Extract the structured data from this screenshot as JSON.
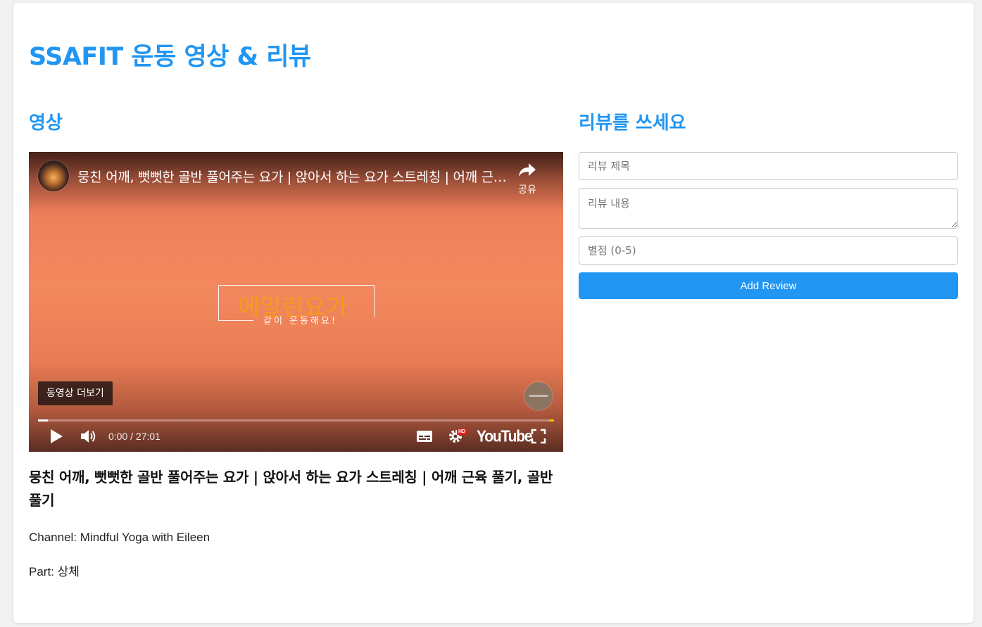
{
  "page": {
    "title": "SSAFIT 운동 영상 & 리뷰"
  },
  "video_section": {
    "heading": "영상",
    "player": {
      "overlay_title": "뭉친 어깨, 뻣뻣한 골반 풀어주는 요가 | 앉아서 하는 요가 스트레칭 | 어깨 근육 풀기, 골반풀기",
      "share_label": "공유",
      "center_logo_text": "에일린요가",
      "center_logo_subtext": "같이 운동해요!",
      "more_videos_label": "동영상 더보기",
      "time_display": "0:00 / 27:01",
      "hd_badge": "HD",
      "youtube_logo": "YouTube",
      "progress_fraction": 0.0,
      "icons": [
        "share-icon",
        "play-icon",
        "volume-icon",
        "subtitles-icon",
        "settings-icon",
        "fullscreen-icon"
      ]
    },
    "video_title": "뭉친 어깨, 뻣뻣한 골반 풀어주는 요가 | 앉아서 하는 요가 스트레칭 | 어깨 근육 풀기, 골반풀기",
    "channel_line": "Channel: Mindful Yoga with Eileen",
    "part_line": "Part: 상체"
  },
  "review_section": {
    "heading": "리뷰를 쓰세요",
    "title_placeholder": "리뷰 제목",
    "content_placeholder": "리뷰 내용",
    "rating_placeholder": "별점 (0-5)",
    "submit_label": "Add Review"
  },
  "colors": {
    "accent": "#2196f3",
    "text": "#111111",
    "border": "#cccccc"
  }
}
